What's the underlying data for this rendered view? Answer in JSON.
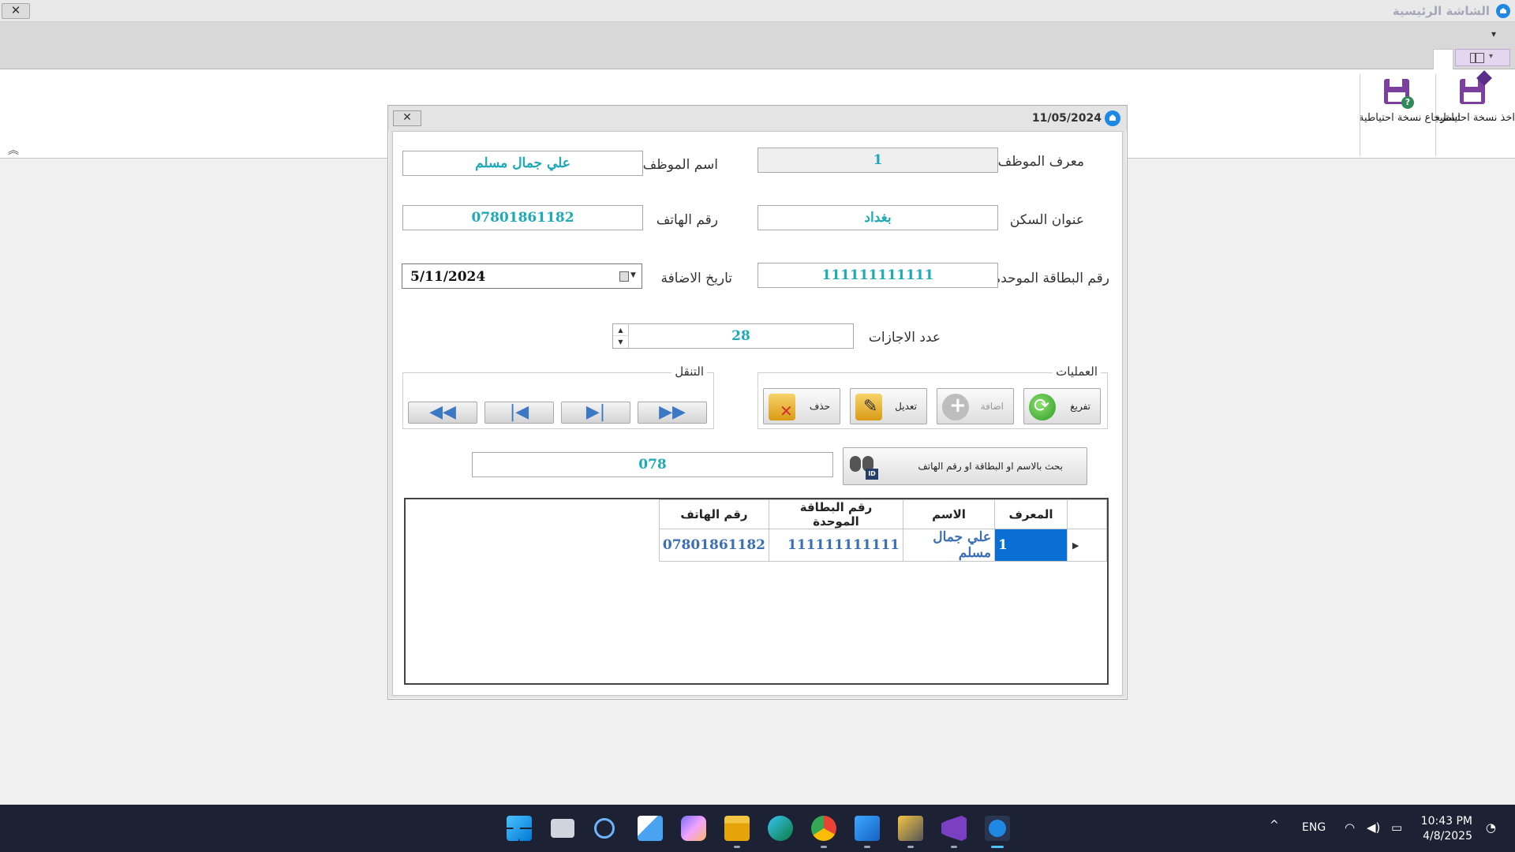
{
  "app": {
    "title": "الشاشة الرئيسية",
    "close_label": "✕",
    "qat_arrow": "▾"
  },
  "ribbon": {
    "backup_label": "اخذ نسخة احتياطية",
    "restore_label": "استرجاع نسخة احتياطية",
    "restore_badge": "?",
    "view_caret": "▾",
    "collapse_glyph": "︽"
  },
  "dialog": {
    "date": "11/05/2024",
    "close_label": "✕",
    "fields": {
      "employee_id_label": "معرف الموظف",
      "employee_id_value": "1",
      "employee_name_label": "اسم الموظف",
      "employee_name_value": "علي جمال مسلم",
      "address_label": "عنوان السكن",
      "address_value": "بغداد",
      "phone_label": "رقم الهاتف",
      "phone_value": "07801861182",
      "national_card_label": "رقم البطاقة الموحدة",
      "national_card_value": "111111111111",
      "add_date_label": "تاريخ الاضافة",
      "add_date_value": "5/11/2024",
      "vacations_label": "عدد الاجازات",
      "vacations_value": "28"
    },
    "operations": {
      "title": "العمليات",
      "clear_label": "تفريغ",
      "add_label": "اضافة",
      "edit_label": "تعديل",
      "delete_label": "حذف"
    },
    "navigation": {
      "title": "التنقل",
      "first_glyph": "◀◀",
      "prev_glyph": "|◀",
      "next_glyph": "▶|",
      "last_glyph": "▶▶"
    },
    "search": {
      "button_label": "بحث بالاسم او البطاقة او رقم الهاتف",
      "value": "078",
      "badge": "ID"
    },
    "grid": {
      "columns": [
        "المعرف",
        "الاسم",
        "رقم البطاقة الموحدة",
        "رقم الهاتف"
      ],
      "row_indicator": "▶",
      "rows": [
        {
          "id": "1",
          "name": "علي جمال مسلم",
          "card": "111111111111",
          "phone": "07801861182"
        }
      ]
    }
  },
  "taskbar": {
    "language": "ENG",
    "time": "10:43 PM",
    "date": "4/8/2025",
    "tray_chevron": "^"
  },
  "colors": {
    "field_text": "#1ca9b8",
    "selection": "#0a6fd4",
    "ribbon_accent": "#7b3fa0",
    "taskbar": "#1c2133"
  }
}
